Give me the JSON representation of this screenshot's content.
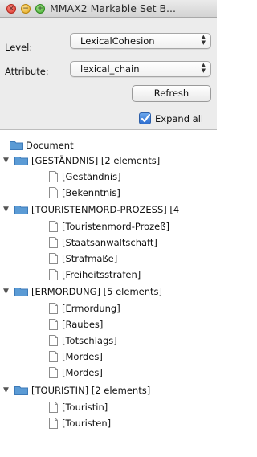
{
  "window": {
    "title": "MMAX2 Markable Set B..."
  },
  "controls": {
    "level_label": "Level:",
    "level_value": "LexicalCohesion",
    "attribute_label": "Attribute:",
    "attribute_value": "lexical_chain",
    "refresh_label": "Refresh",
    "expand_all_label": "Expand all",
    "expand_all_checked": true
  },
  "tree": {
    "root": "Document",
    "groups": [
      {
        "label": "[GESTÄNDNIS] [2 elements]",
        "items": [
          "[Geständnis]",
          "[Bekenntnis]"
        ]
      },
      {
        "label": "[TOURISTENMORD-PROZESS] [4",
        "items": [
          "[Touristenmord-Prozeß]",
          "[Staatsanwaltschaft]",
          "[Strafmaße]",
          "[Freiheitsstrafen]"
        ]
      },
      {
        "label": "[ERMORDUNG] [5 elements]",
        "items": [
          "[Ermordung]",
          "[Raubes]",
          "[Totschlags]",
          "[Mordes]",
          "[Mordes]"
        ]
      },
      {
        "label": "[TOURISTIN] [2 elements]",
        "items": [
          "[Touristin]",
          "[Touristen]"
        ]
      }
    ]
  },
  "colors": {
    "folder_blue": "#5b9bd5",
    "checkbox_blue": "#2f6fd0"
  }
}
